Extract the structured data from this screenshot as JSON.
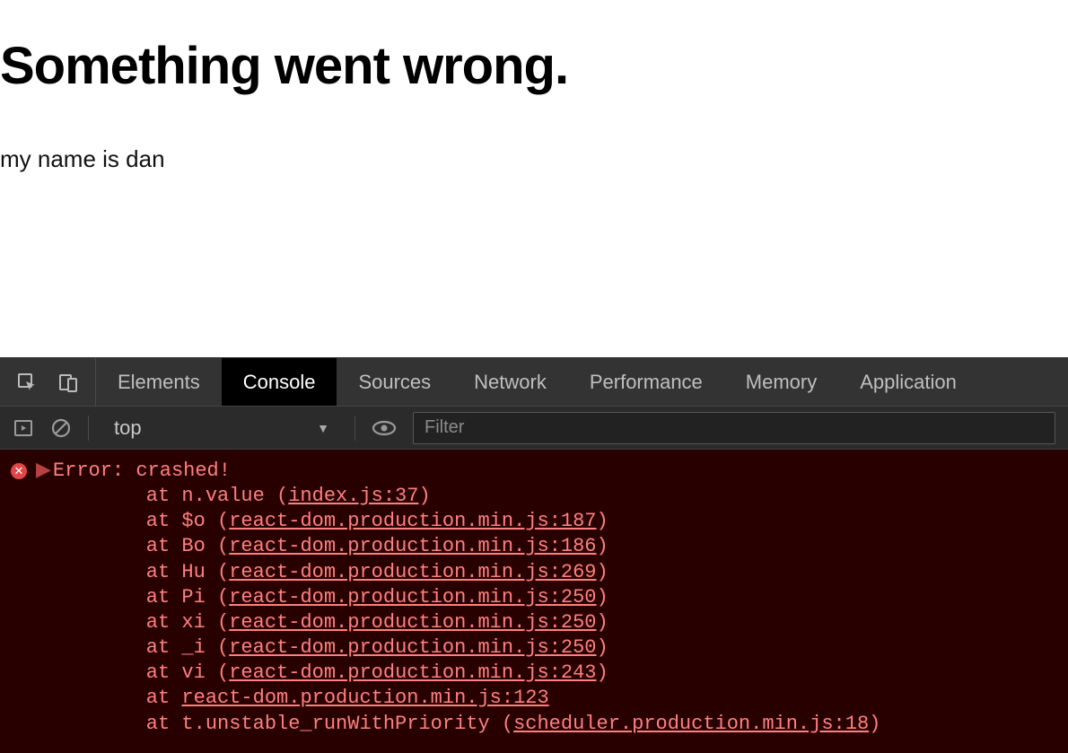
{
  "page": {
    "heading": "Something went wrong.",
    "subtext": "my name is dan"
  },
  "devtools": {
    "tabs": [
      "Elements",
      "Console",
      "Sources",
      "Network",
      "Performance",
      "Memory",
      "Application"
    ],
    "active_tab": "Console",
    "toolbar": {
      "context": "top",
      "filter_placeholder": "Filter"
    },
    "console": {
      "error_head": "Error: crashed!",
      "stack": [
        {
          "prefix": "    at n.value (",
          "link": "index.js:37",
          "suffix": ")"
        },
        {
          "prefix": "    at $o (",
          "link": "react-dom.production.min.js:187",
          "suffix": ")"
        },
        {
          "prefix": "    at Bo (",
          "link": "react-dom.production.min.js:186",
          "suffix": ")"
        },
        {
          "prefix": "    at Hu (",
          "link": "react-dom.production.min.js:269",
          "suffix": ")"
        },
        {
          "prefix": "    at Pi (",
          "link": "react-dom.production.min.js:250",
          "suffix": ")"
        },
        {
          "prefix": "    at xi (",
          "link": "react-dom.production.min.js:250",
          "suffix": ")"
        },
        {
          "prefix": "    at _i (",
          "link": "react-dom.production.min.js:250",
          "suffix": ")"
        },
        {
          "prefix": "    at vi (",
          "link": "react-dom.production.min.js:243",
          "suffix": ")"
        },
        {
          "prefix": "    at ",
          "link": "react-dom.production.min.js:123",
          "suffix": ""
        },
        {
          "prefix": "    at t.unstable_runWithPriority (",
          "link": "scheduler.production.min.js:18",
          "suffix": ")"
        }
      ]
    }
  }
}
